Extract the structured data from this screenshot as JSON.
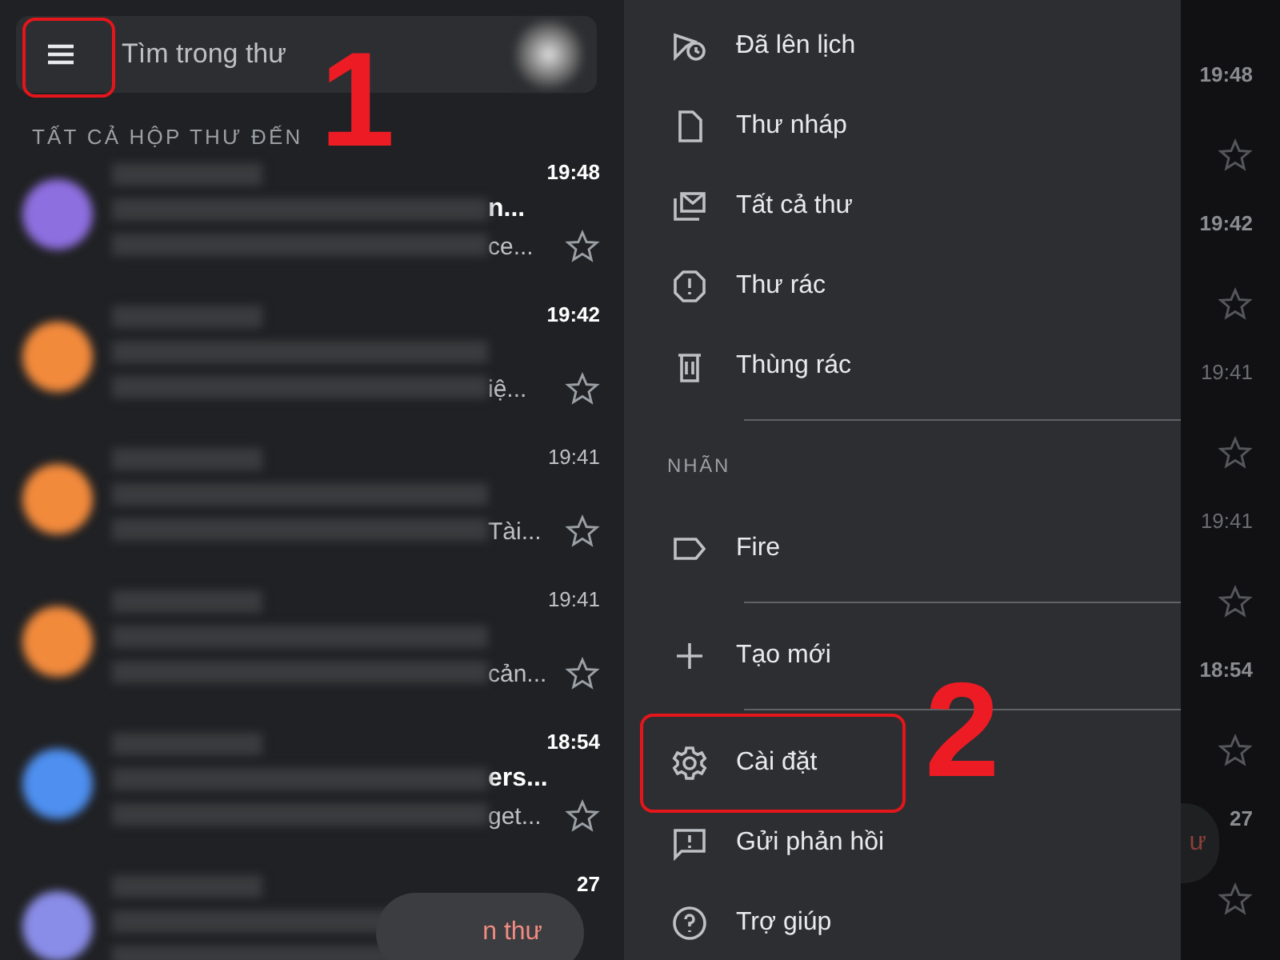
{
  "inbox": {
    "search": {
      "placeholder": "Tìm trong thư",
      "menu_callout": "1"
    },
    "section_label": "TẤT CẢ HỘP THƯ ĐẾN",
    "emails": [
      {
        "color": "#8e6fe0",
        "time": "19:48",
        "unread": true,
        "subject_end": "n...",
        "snippet_end": "ce..."
      },
      {
        "color": "#f28a3c",
        "time": "19:42",
        "unread": true,
        "snippet_end": "iệ..."
      },
      {
        "color": "#f28a3c",
        "time": "19:41",
        "unread": false,
        "snippet_end": "Tài..."
      },
      {
        "color": "#f28a3c",
        "time": "19:41",
        "unread": false,
        "snippet_end": "cản..."
      },
      {
        "color": "#4e8ff0",
        "time": "18:54",
        "unread": true,
        "subject_end": "ers...",
        "snippet_end": "get..."
      },
      {
        "color": "#8a8de8",
        "time": "27",
        "unread": true
      }
    ],
    "compose": {
      "label": "n thư"
    }
  },
  "drawer": {
    "sections": [
      {
        "items": [
          {
            "label": "Đã lên lịch"
          },
          {
            "label": "Thư nháp"
          },
          {
            "label": "Tất cả thư"
          },
          {
            "label": "Thư rác"
          },
          {
            "label": "Thùng rác"
          }
        ]
      },
      {
        "title": "NHÃN",
        "items": [
          {
            "label": "Fire"
          }
        ]
      },
      {
        "items": [
          {
            "label": "Tạo mới"
          }
        ]
      },
      {
        "items": [
          {
            "label": "Cài đặt",
            "callout": "2"
          },
          {
            "label": "Gửi phản hồi"
          },
          {
            "label": "Trợ giúp"
          }
        ]
      }
    ]
  },
  "background_list": {
    "rows": [
      {
        "time": "19:48",
        "unread": true
      },
      {
        "time": "19:42",
        "unread": true
      },
      {
        "time": "19:41",
        "unread": false
      },
      {
        "time": "19:41",
        "unread": false
      },
      {
        "time": "18:54",
        "unread": true
      },
      {
        "time": "27",
        "unread": true
      }
    ],
    "compose": {
      "label": "ư"
    }
  }
}
